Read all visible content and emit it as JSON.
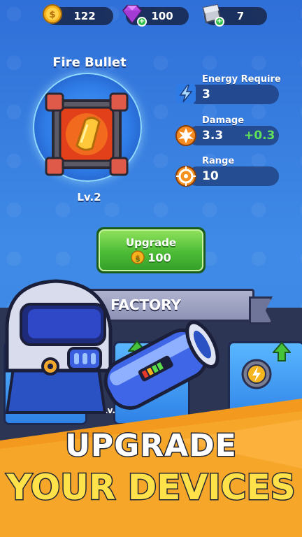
{
  "resources": {
    "coins": "122",
    "gems": "100",
    "plates": "7"
  },
  "weapon": {
    "name": "Fire Bullet",
    "level": "Lv.2"
  },
  "stats": [
    {
      "label": "Energy Require",
      "value": "3",
      "bonus": ""
    },
    {
      "label": "Damage",
      "value": "3.3",
      "bonus": "+0.3"
    },
    {
      "label": "Range",
      "value": "10",
      "bonus": ""
    }
  ],
  "upgrade_button": {
    "label": "Upgrade",
    "cost": "100"
  },
  "factory": {
    "title": "FACTORY",
    "card_level": "Lv."
  },
  "promo": {
    "line1": "UPGRADE",
    "line2": "YOUR DEVICES"
  },
  "colors": {
    "background": "#3a86e2",
    "upgrade_green": "#4cbc37",
    "bonus_green": "#61e25a",
    "promo_yellow": "#ffe24a",
    "promo_orange": "#f39a1e"
  },
  "icons": {
    "coin": "coin-icon",
    "gem": "gem-icon",
    "plate": "metal-plate-icon",
    "energy": "lightning-icon",
    "damage": "explosion-icon",
    "range": "target-icon"
  }
}
